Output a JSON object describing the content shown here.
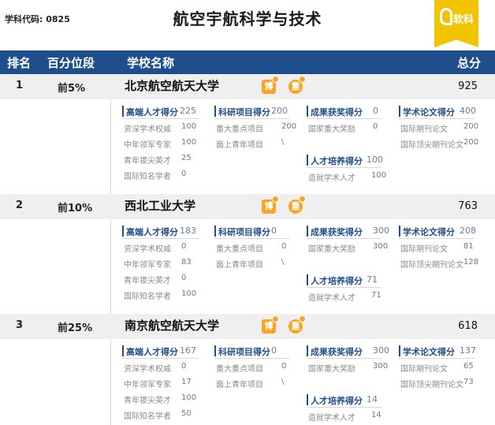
{
  "page": {
    "code_label": "学科代码: 0825",
    "title": "航空宇航科学与技术",
    "logo_text": "软科"
  },
  "header": {
    "rank": "排名",
    "percentile": "百分位段",
    "school": "学校名称",
    "total": "总分"
  },
  "badges": {
    "bo": "博",
    "zhong": "重"
  },
  "rows": [
    {
      "rank": "1",
      "percentile": "前5%",
      "school": "北京航空航天大学",
      "total": "925",
      "talent": {
        "label": "高端人才得分",
        "value": "225",
        "items": [
          {
            "label": "资深学术权威",
            "value": "100"
          },
          {
            "label": "中年领军专家",
            "value": "100"
          },
          {
            "label": "青年拔尖英才",
            "value": "25"
          },
          {
            "label": "国际知名学者",
            "value": "0"
          }
        ]
      },
      "research": {
        "label": "科研项目得分",
        "value": "200",
        "items": [
          {
            "label": "重大重点项目",
            "value": "200"
          },
          {
            "label": "面上青年项目",
            "value": "\\"
          }
        ]
      },
      "award": {
        "label": "成果获奖得分",
        "value": "0",
        "items": [
          {
            "label": "国家重大奖励",
            "value": "0"
          }
        ]
      },
      "training": {
        "label": "人才培养得分",
        "value": "100",
        "items": [
          {
            "label": "造就学术人才",
            "value": "100"
          }
        ]
      },
      "paper": {
        "label": "学术论文得分",
        "value": "400",
        "items": [
          {
            "label": "国际期刊论文",
            "value": "200"
          },
          {
            "label": "国际顶尖期刊论文",
            "value": "200"
          }
        ]
      }
    },
    {
      "rank": "2",
      "percentile": "前10%",
      "school": "西北工业大学",
      "total": "763",
      "talent": {
        "label": "高端人才得分",
        "value": "183",
        "items": [
          {
            "label": "资深学术权威",
            "value": "0"
          },
          {
            "label": "中年领军专家",
            "value": "83"
          },
          {
            "label": "青年拔尖英才",
            "value": "0"
          },
          {
            "label": "国际知名学者",
            "value": "100"
          }
        ]
      },
      "research": {
        "label": "科研项目得分",
        "value": "0",
        "items": [
          {
            "label": "重大重点项目",
            "value": "0"
          },
          {
            "label": "面上青年项目",
            "value": "\\"
          }
        ]
      },
      "award": {
        "label": "成果获奖得分",
        "value": "300",
        "items": [
          {
            "label": "国家重大奖励",
            "value": "300"
          }
        ]
      },
      "training": {
        "label": "人才培养得分",
        "value": "71",
        "items": [
          {
            "label": "造就学术人才",
            "value": "71"
          }
        ]
      },
      "paper": {
        "label": "学术论文得分",
        "value": "208",
        "items": [
          {
            "label": "国际期刊论文",
            "value": "81"
          },
          {
            "label": "国际顶尖期刊论文",
            "value": "128"
          }
        ]
      }
    },
    {
      "rank": "3",
      "percentile": "前25%",
      "school": "南京航空航天大学",
      "total": "618",
      "talent": {
        "label": "高端人才得分",
        "value": "167",
        "items": [
          {
            "label": "资深学术权威",
            "value": "0"
          },
          {
            "label": "中年领军专家",
            "value": "17"
          },
          {
            "label": "青年拔尖英才",
            "value": "100"
          },
          {
            "label": "国际知名学者",
            "value": "50"
          }
        ]
      },
      "research": {
        "label": "科研项目得分",
        "value": "0",
        "items": [
          {
            "label": "重大重点项目",
            "value": "0"
          },
          {
            "label": "面上青年项目",
            "value": "\\"
          }
        ]
      },
      "award": {
        "label": "成果获奖得分",
        "value": "300",
        "items": [
          {
            "label": "国家重大奖励",
            "value": "300"
          }
        ]
      },
      "training": {
        "label": "人才培养得分",
        "value": "14",
        "items": [
          {
            "label": "造就学术人才",
            "value": "14"
          }
        ]
      },
      "paper": {
        "label": "学术论文得分",
        "value": "137",
        "items": [
          {
            "label": "国际期刊论文",
            "value": "65"
          },
          {
            "label": "国际顶尖期刊论文",
            "value": "73"
          }
        ]
      }
    }
  ]
}
